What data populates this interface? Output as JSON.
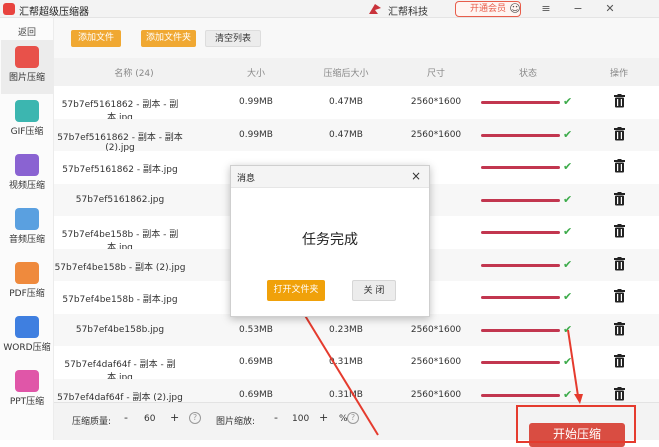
{
  "app": {
    "title": "汇帮超级压缩器",
    "brand": "汇帮科技",
    "vip": "开通会员"
  },
  "sidebar": {
    "back": "返回",
    "items": [
      {
        "label": "图片压缩",
        "color": "#e8514a",
        "active": true
      },
      {
        "label": "GIF压缩",
        "color": "#3cb6b0"
      },
      {
        "label": "视频压缩",
        "color": "#8a63d2"
      },
      {
        "label": "音频压缩",
        "color": "#5aa0e0"
      },
      {
        "label": "PDF压缩",
        "color": "#ef8a3d"
      },
      {
        "label": "WORD压缩",
        "color": "#3f7fe0"
      },
      {
        "label": "PPT压缩",
        "color": "#e056a8"
      }
    ]
  },
  "toolbar": {
    "add_file": "添加文件",
    "add_folder": "添加文件夹",
    "clear_list": "清空列表"
  },
  "table": {
    "headers": [
      "名称 (24)",
      "大小",
      "压缩后大小",
      "尺寸",
      "状态",
      "操作"
    ],
    "rows": [
      {
        "name": "57b7ef5161862 - 副本 - 副本.jpg",
        "size": "0.99MB",
        "csize": "0.47MB",
        "dim": "2560*1600",
        "progress": 1
      },
      {
        "name": "57b7ef5161862 - 副本 - 副本 (2).jpg",
        "size": "0.99MB",
        "csize": "0.47MB",
        "dim": "2560*1600",
        "progress": 1
      },
      {
        "name": "57b7ef5161862 - 副本.jpg",
        "size": "",
        "csize": "",
        "dim": "",
        "progress": 1
      },
      {
        "name": "57b7ef5161862.jpg",
        "size": "",
        "csize": "",
        "dim": "",
        "progress": 1
      },
      {
        "name": "57b7ef4be158b - 副本 - 副本.jpg",
        "size": "",
        "csize": "",
        "dim": "",
        "progress": 1
      },
      {
        "name": "57b7ef4be158b - 副本 (2).jpg",
        "size": "",
        "csize": "",
        "dim": "",
        "progress": 1
      },
      {
        "name": "57b7ef4be158b - 副本.jpg",
        "size": "",
        "csize": "",
        "dim": "",
        "progress": 1
      },
      {
        "name": "57b7ef4be158b.jpg",
        "size": "0.53MB",
        "csize": "0.23MB",
        "dim": "2560*1600",
        "progress": 1
      },
      {
        "name": "57b7ef4daf64f - 副本 - 副本.jpg",
        "size": "0.69MB",
        "csize": "0.31MB",
        "dim": "2560*1600",
        "progress": 1
      },
      {
        "name": "57b7ef4daf64f - 副本 (2).jpg",
        "size": "0.69MB",
        "csize": "0.31MB",
        "dim": "2560*1600",
        "progress": 1
      }
    ]
  },
  "bottom": {
    "quality_label": "压缩质量:",
    "minus": "-",
    "quality_value": "60",
    "plus": "+",
    "scale_label": "图片缩放:",
    "scale_value": "100",
    "percent": "%",
    "help": "?",
    "start": "开始压缩"
  },
  "dialog": {
    "title": "消息",
    "close": "×",
    "message": "任务完成",
    "open_folder": "打开文件夹",
    "close_btn": "关 闭"
  }
}
